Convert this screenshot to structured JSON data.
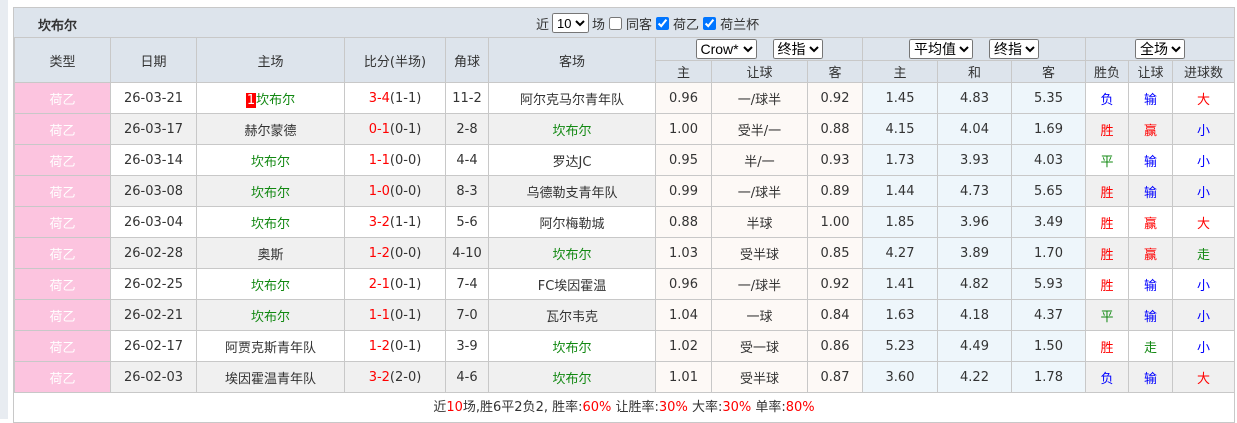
{
  "team": "坎布尔",
  "filters": {
    "near_label": "近",
    "count": "10",
    "match_label": "场",
    "same_home_label": "同客",
    "same_home_checked": false,
    "league1_label": "荷乙",
    "league1_checked": true,
    "league2_label": "荷兰杯",
    "league2_checked": true
  },
  "headers": {
    "type": "类型",
    "date": "日期",
    "home": "主场",
    "score": "比分(半场)",
    "corner": "角球",
    "away": "客场",
    "company": "Crow*",
    "odds_type": "终指",
    "avg": "平均值",
    "odds_type2": "终指",
    "period": "全场",
    "h_home": "主",
    "h_hcap": "让球",
    "h_away": "客",
    "e_home": "主",
    "e_draw": "和",
    "e_away": "客",
    "result": "胜负",
    "hcap_result": "让球",
    "goals": "进球数"
  },
  "colors": {
    "type_bg": "#fcc4df",
    "team": "#118811",
    "win": "#ff0000",
    "loss": "#0000ff",
    "draw": "#118811"
  },
  "rows": [
    {
      "type": "荷乙",
      "date": "26-03-21",
      "rank": "1",
      "home": "坎布尔",
      "home_hl": true,
      "score": "3-4",
      "half": "(1-1)",
      "corner": "11-2",
      "away": "阿尔克马尔青年队",
      "away_hl": false,
      "h": "0.96",
      "hc": "一/球半",
      "a": "0.92",
      "eh": "1.45",
      "ed": "4.83",
      "ea": "5.35",
      "r": "负",
      "rc": "blue",
      "hr": "输",
      "hrc": "blue",
      "g": "大",
      "gc": "red"
    },
    {
      "type": "荷乙",
      "date": "26-03-17",
      "home": "赫尔蒙德",
      "home_hl": false,
      "score": "0-1",
      "half": "(0-1)",
      "corner": "2-8",
      "away": "坎布尔",
      "away_hl": true,
      "h": "1.00",
      "hc": "受半/一",
      "a": "0.88",
      "eh": "4.15",
      "ed": "4.04",
      "ea": "1.69",
      "r": "胜",
      "rc": "red",
      "hr": "赢",
      "hrc": "red",
      "g": "小",
      "gc": "blue"
    },
    {
      "type": "荷乙",
      "date": "26-03-14",
      "home": "坎布尔",
      "home_hl": true,
      "score": "1-1",
      "half": "(0-0)",
      "corner": "4-4",
      "away": "罗达JC",
      "away_hl": false,
      "h": "0.95",
      "hc": "半/一",
      "a": "0.93",
      "eh": "1.73",
      "ed": "3.93",
      "ea": "4.03",
      "r": "平",
      "rc": "green",
      "hr": "输",
      "hrc": "blue",
      "g": "小",
      "gc": "blue"
    },
    {
      "type": "荷乙",
      "date": "26-03-08",
      "home": "坎布尔",
      "home_hl": true,
      "score": "1-0",
      "half": "(0-0)",
      "corner": "8-3",
      "away": "乌德勒支青年队",
      "away_hl": false,
      "h": "0.99",
      "hc": "一/球半",
      "a": "0.89",
      "eh": "1.44",
      "ed": "4.73",
      "ea": "5.65",
      "r": "胜",
      "rc": "red",
      "hr": "输",
      "hrc": "blue",
      "g": "小",
      "gc": "blue"
    },
    {
      "type": "荷乙",
      "date": "26-03-04",
      "home": "坎布尔",
      "home_hl": true,
      "score": "3-2",
      "half": "(1-1)",
      "corner": "5-6",
      "away": "阿尔梅勒城",
      "away_hl": false,
      "h": "0.88",
      "hc": "半球",
      "a": "1.00",
      "eh": "1.85",
      "ed": "3.96",
      "ea": "3.49",
      "r": "胜",
      "rc": "red",
      "hr": "赢",
      "hrc": "red",
      "g": "大",
      "gc": "red"
    },
    {
      "type": "荷乙",
      "date": "26-02-28",
      "home": "奥斯",
      "home_hl": false,
      "score": "1-2",
      "half": "(0-0)",
      "corner": "4-10",
      "away": "坎布尔",
      "away_hl": true,
      "h": "1.03",
      "hc": "受半球",
      "a": "0.85",
      "eh": "4.27",
      "ed": "3.89",
      "ea": "1.70",
      "r": "胜",
      "rc": "red",
      "hr": "赢",
      "hrc": "red",
      "g": "走",
      "gc": "green"
    },
    {
      "type": "荷乙",
      "date": "26-02-25",
      "home": "坎布尔",
      "home_hl": true,
      "score": "2-1",
      "half": "(0-1)",
      "corner": "7-4",
      "away": "FC埃因霍温",
      "away_hl": false,
      "h": "0.96",
      "hc": "一/球半",
      "a": "0.92",
      "eh": "1.41",
      "ed": "4.82",
      "ea": "5.93",
      "r": "胜",
      "rc": "red",
      "hr": "输",
      "hrc": "blue",
      "g": "小",
      "gc": "blue"
    },
    {
      "type": "荷乙",
      "date": "26-02-21",
      "home": "坎布尔",
      "home_hl": true,
      "score": "1-1",
      "half": "(0-1)",
      "corner": "7-0",
      "away": "瓦尔韦克",
      "away_hl": false,
      "h": "1.04",
      "hc": "一球",
      "a": "0.84",
      "eh": "1.63",
      "ed": "4.18",
      "ea": "4.37",
      "r": "平",
      "rc": "green",
      "hr": "输",
      "hrc": "blue",
      "g": "小",
      "gc": "blue"
    },
    {
      "type": "荷乙",
      "date": "26-02-17",
      "home": "阿贾克斯青年队",
      "home_hl": false,
      "score": "1-2",
      "half": "(0-1)",
      "corner": "3-9",
      "away": "坎布尔",
      "away_hl": true,
      "h": "1.02",
      "hc": "受一球",
      "a": "0.86",
      "eh": "5.23",
      "ed": "4.49",
      "ea": "1.50",
      "r": "胜",
      "rc": "red",
      "hr": "走",
      "hrc": "green",
      "g": "小",
      "gc": "blue"
    },
    {
      "type": "荷乙",
      "date": "26-02-03",
      "home": "埃因霍温青年队",
      "home_hl": false,
      "score": "3-2",
      "half": "(2-0)",
      "corner": "4-6",
      "away": "坎布尔",
      "away_hl": true,
      "h": "1.01",
      "hc": "受半球",
      "a": "0.87",
      "eh": "3.60",
      "ed": "4.22",
      "ea": "1.78",
      "r": "负",
      "rc": "blue",
      "hr": "输",
      "hrc": "blue",
      "g": "大",
      "gc": "red"
    }
  ],
  "summary": {
    "p1": "近",
    "n": "10",
    "p2": "场,胜6平2负2, 胜率:",
    "win_rate": "60%",
    "p3": " 让胜率:",
    "hcap_rate": "30%",
    "p4": " 大率:",
    "big_rate": "30%",
    "p5": " 单率:",
    "odd_rate": "80%"
  }
}
